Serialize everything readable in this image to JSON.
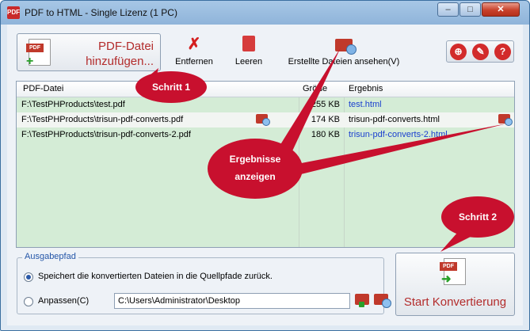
{
  "window": {
    "title": "PDF to HTML - Single Lizenz (1 PC)",
    "min": "–",
    "max": "□",
    "close": "✕"
  },
  "toolbar": {
    "add_line1": "PDF-Datei",
    "add_line2": "hinzufügen...",
    "remove": "Entfernen",
    "empty": "Leeren",
    "view": "Erstellte Dateien ansehen(V)"
  },
  "right_tools": {
    "web": "⊕",
    "settings": "✎",
    "help": "?"
  },
  "grid": {
    "columns": [
      "PDF-Datei",
      "Größe",
      "Ergebnis"
    ],
    "rows": [
      {
        "pdf": "F:\\TestPHProducts\\test.pdf",
        "size": "255 KB",
        "result": "test.html"
      },
      {
        "pdf": "F:\\TestPHProducts\\trisun-pdf-converts.pdf",
        "size": "174 KB",
        "result": "trisun-pdf-converts.html"
      },
      {
        "pdf": "F:\\TestPHProducts\\trisun-pdf-converts-2.pdf",
        "size": "180 KB",
        "result": "trisun-pdf-converts-2.html"
      }
    ]
  },
  "output": {
    "group_label": "Ausgabepfad",
    "option_source": "Speichert die konvertierten Dateien in die Quellpfade zurück.",
    "option_custom": "Anpassen(C)",
    "path": "C:\\Users\\Administrator\\Desktop"
  },
  "start": {
    "label": "Start Konvertierung"
  },
  "annotations": {
    "step1": "Schritt 1",
    "step2": "Schritt 2",
    "results_line1": "Ergebnisse",
    "results_line2": "anzeigen"
  },
  "colors": {
    "accent_red": "#b32c2c",
    "grid_green": "#d4ecd6",
    "link_blue": "#1a3fcf",
    "bubble_red": "#c8102e"
  }
}
